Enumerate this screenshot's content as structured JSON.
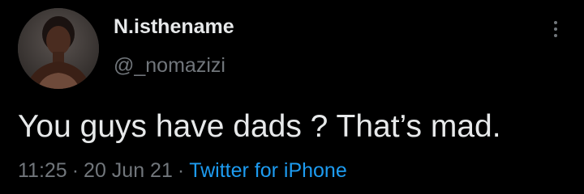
{
  "author": {
    "display_name": "N.isthename",
    "handle": "@_nomazizi"
  },
  "tweet": {
    "text": "You guys have dads ? That’s mad.",
    "time": "11:25",
    "separator": "·",
    "date": "20 Jun 21",
    "source": "Twitter for iPhone"
  },
  "icons": {
    "more": "more-vertical-icon",
    "avatar": "profile-photo"
  },
  "colors": {
    "background": "#000000",
    "primary_text": "#e7e9ea",
    "secondary_text": "#71767b",
    "link": "#1d9bf0"
  }
}
